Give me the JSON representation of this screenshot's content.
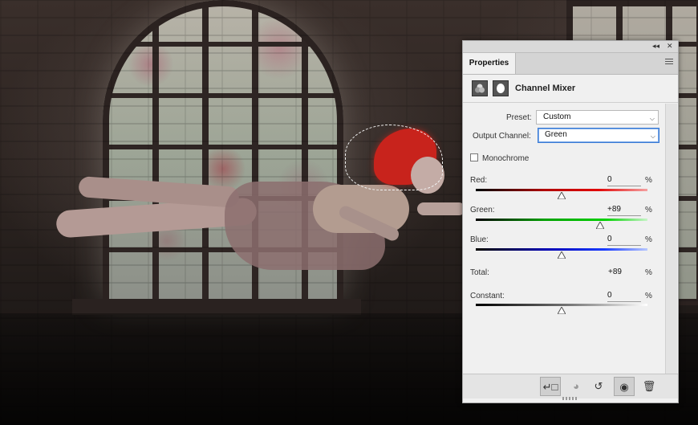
{
  "panel": {
    "tab_label": "Properties",
    "adjustment_title": "Channel Mixer",
    "preset": {
      "label": "Preset:",
      "value": "Custom"
    },
    "output_channel": {
      "label": "Output Channel:",
      "value": "Green"
    },
    "monochrome": {
      "label": "Monochrome",
      "checked": false
    },
    "channels": [
      {
        "label": "Red:",
        "value": "0",
        "unit": "%",
        "level": 0
      },
      {
        "label": "Green:",
        "value": "+89",
        "unit": "%",
        "level": 89
      },
      {
        "label": "Blue:",
        "value": "0",
        "unit": "%",
        "level": 0
      }
    ],
    "total": {
      "label": "Total:",
      "value": "+89",
      "unit": "%"
    },
    "constant": {
      "label": "Constant:",
      "value": "0",
      "unit": "%",
      "level": 0
    },
    "slider_range": [
      -200,
      200
    ],
    "icons": {
      "collapse": "double-chevron-right-icon",
      "close": "close-icon",
      "menu": "hamburger-menu-icon",
      "clip": "clip-to-layer-icon",
      "view_previous": "view-previous-state-icon",
      "reset": "reset-icon",
      "visibility": "eye-icon",
      "delete": "trash-icon"
    }
  }
}
